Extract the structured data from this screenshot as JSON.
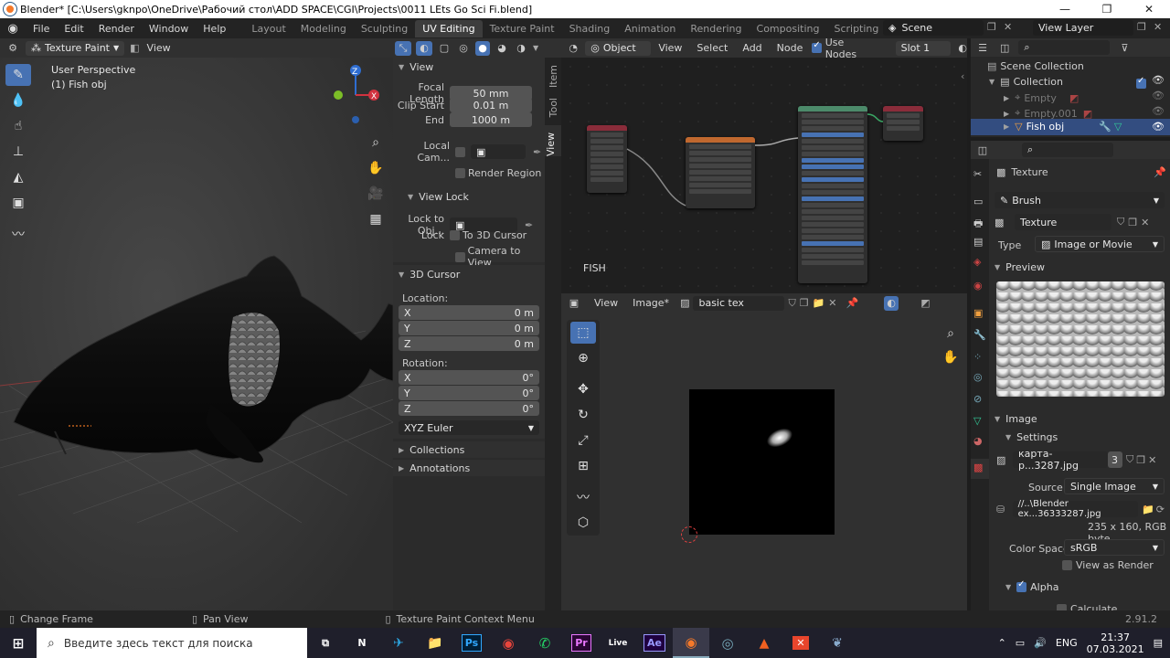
{
  "window": {
    "title": "Blender* [C:\\Users\\gknpo\\OneDrive\\Рабочий стол\\ADD SPACE\\CGI\\Projects\\0011 LEts Go Sci Fi.blend]"
  },
  "menu": [
    "File",
    "Edit",
    "Render",
    "Window",
    "Help"
  ],
  "workspaces": [
    "Layout",
    "Modeling",
    "Sculpting",
    "UV Editing",
    "Texture Paint",
    "Shading",
    "Animation",
    "Rendering",
    "Compositing",
    "Scripting"
  ],
  "active_workspace": "UV Editing",
  "scene": "Scene",
  "view_layer": "View Layer",
  "viewport": {
    "mode": "Texture Paint",
    "view_menu": "View",
    "overlay_line1": "User Perspective",
    "overlay_line2": "(1) Fish obj",
    "tabs": [
      "Item",
      "Tool",
      "View"
    ],
    "view_panel": {
      "title": "View",
      "focal_length_label": "Focal Length",
      "focal_length": "50 mm",
      "clip_start_label": "Clip Start",
      "clip_start": "0.01 m",
      "end_label": "End",
      "end": "1000 m",
      "local_camera_label": "Local Cam...",
      "render_region_label": "Render Region",
      "view_lock_title": "View Lock",
      "lock_to_obj_label": "Lock to Obj...",
      "lock_label": "Lock",
      "to_3d_cursor_label": "To 3D Cursor",
      "camera_to_view_label": "Camera to View"
    },
    "cursor_panel": {
      "title": "3D Cursor",
      "location_label": "Location:",
      "loc_x_label": "X",
      "loc_x": "0 m",
      "loc_y_label": "Y",
      "loc_y": "0 m",
      "loc_z_label": "Z",
      "loc_z": "0 m",
      "rotation_label": "Rotation:",
      "rot_x_label": "X",
      "rot_x": "0°",
      "rot_y_label": "Y",
      "rot_y": "0°",
      "rot_z_label": "Z",
      "rot_z": "0°",
      "rotation_mode": "XYZ Euler"
    },
    "collections_title": "Collections",
    "annotations_title": "Annotations",
    "gizmo": {
      "x": "X",
      "y": "Y",
      "z": "Z"
    }
  },
  "node_editor": {
    "object_label": "Object",
    "view": "View",
    "select": "Select",
    "add": "Add",
    "node": "Node",
    "use_nodes": "Use Nodes",
    "slot": "Slot 1",
    "material_name": "FISH"
  },
  "image_editor": {
    "view": "View",
    "image_menu": "Image*",
    "image_name": "basic tex"
  },
  "outliner": {
    "scene_collection": "Scene Collection",
    "collection": "Collection",
    "items": [
      "Empty",
      "Empty.001",
      "Fish obj"
    ]
  },
  "properties": {
    "panel_title": "Texture",
    "brush": "Brush",
    "texture_name": "Texture",
    "type_label": "Type",
    "type_value": "Image or Movie",
    "preview_title": "Preview",
    "image_title": "Image",
    "settings_title": "Settings",
    "image_datablock": "карта-р...3287.jpg",
    "image_users": "3",
    "source_label": "Source",
    "source_value": "Single Image",
    "filepath": "//..\\Blender ex...36333287.jpg",
    "image_info": "235 x 160,  RGB byte",
    "color_space_label": "Color Space",
    "color_space": "sRGB",
    "view_as_render": "View as Render",
    "alpha_title": "Alpha",
    "calculate": "Calculate"
  },
  "statusbar": {
    "left": "Change Frame",
    "middle": "Pan View",
    "context": "Texture Paint Context Menu",
    "version": "2.91.2"
  },
  "taskbar": {
    "search_placeholder": "Введите здесь текст для поиска",
    "lang": "ENG",
    "time": "21:37",
    "date": "07.03.2021"
  },
  "colors": {
    "accent": "#4772b3",
    "window_bg": "#1d1d1d",
    "panel_bg": "#303030",
    "field": "#545454"
  }
}
